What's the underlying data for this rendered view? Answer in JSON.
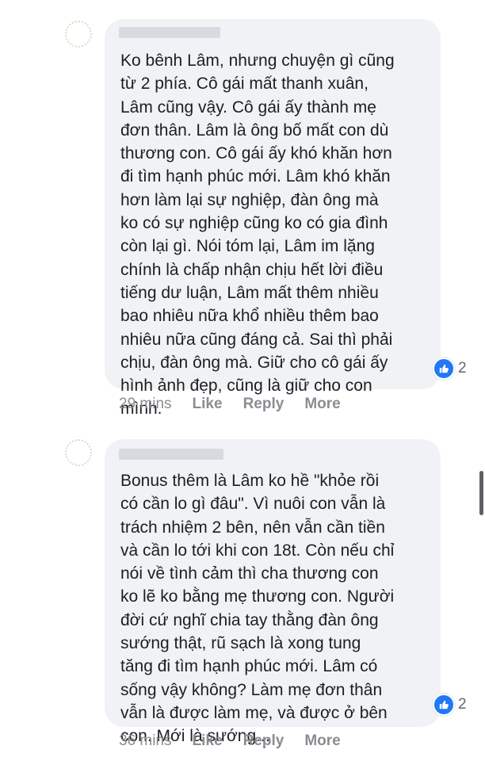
{
  "comments": [
    {
      "text": "Ko bênh Lâm, nhưng chuyện gì cũng\ntừ 2 phía. Cô gái mất thanh xuân,\nLâm cũng vậy. Cô gái ấy thành mẹ\nđơn thân. Lâm là ông bố mất con dù\nthương con. Cô gái ấy khó khăn hơn\nđi tìm hạnh phúc mới. Lâm khó khăn\nhơn làm lại sự nghiệp, đàn ông mà\nko có sự nghiệp cũng ko có gia đình\ncòn lại gì. Nói tóm lại, Lâm im lặng\nchính là chấp nhận chịu hết lời điều\ntiếng dư luận, Lâm mất thêm nhiều\nbao nhiêu nữa khổ nhiều thêm bao\nnhiêu nữa cũng đáng cả. Sai thì phải\nchịu, đàn ông mà. Giữ cho cô gái ấy\nhình ảnh đẹp, cũng là giữ cho con\nmình.",
      "reaction_count": "2",
      "time": "29 mins",
      "like_label": "Like",
      "reply_label": "Reply",
      "more_label": "More"
    },
    {
      "text": "Bonus thêm là Lâm ko hề \"khỏe rồi\ncó cần lo gì đâu\". Vì nuôi con vẫn là\ntrách nhiệm 2 bên, nên vẫn cần tiền\nvà cần lo tới khi con 18t. Còn nếu chỉ\nnói về tình cảm thì cha thương con\nko lẽ ko bằng mẹ thương con. Người\nđời cứ nghĩ chia tay thằng đàn ông\nsướng thật, rũ sạch là xong tung\ntăng đi tìm hạnh phúc mới. Lâm có\nsống vậy không? Làm mẹ đơn thân\nvẫn là được làm mẹ, và được ở bên\ncon. Mới là sướng...",
      "reaction_count": "2",
      "time": "36 mins",
      "like_label": "Like",
      "reply_label": "Reply",
      "more_label": "More"
    }
  ],
  "colors": {
    "bubble": "#f0f2f5",
    "meta_text": "#8a8d91",
    "like_blue": "#2078f4"
  }
}
